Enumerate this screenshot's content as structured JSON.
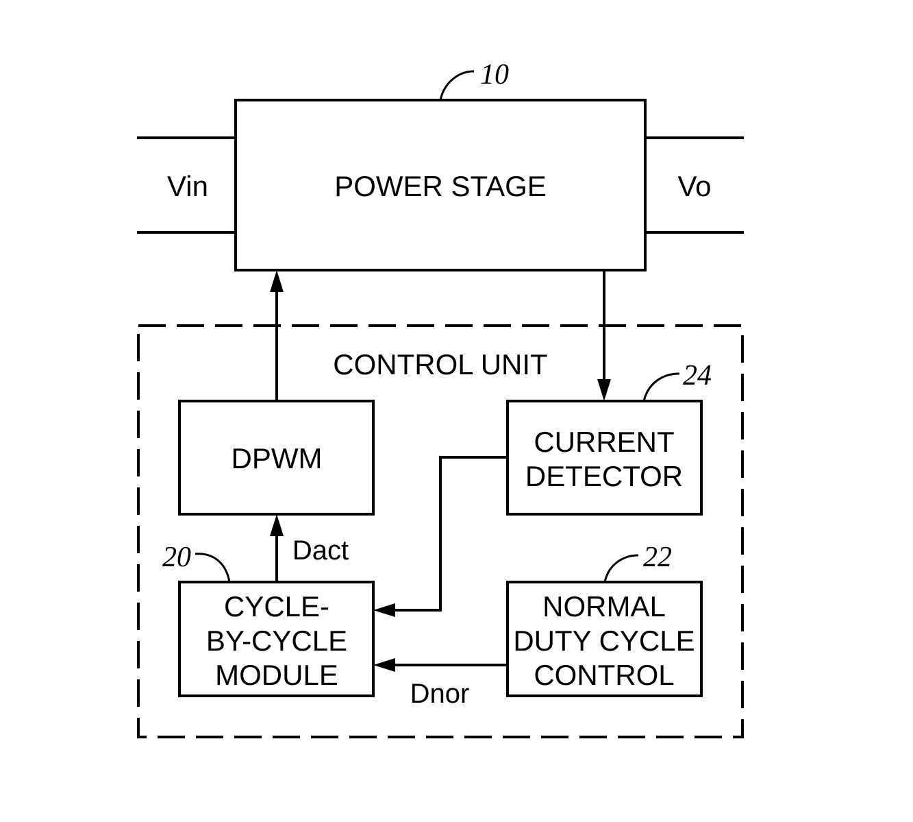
{
  "diagram": {
    "power_stage": {
      "label": "POWER STAGE",
      "ref": "10"
    },
    "input_terminal": {
      "label": "Vin"
    },
    "output_terminal": {
      "label": "Vo"
    },
    "control_unit": {
      "label": "CONTROL UNIT"
    },
    "dpwm": {
      "label": "DPWM"
    },
    "current_detector": {
      "lines": [
        "CURRENT",
        "DETECTOR"
      ],
      "ref": "24"
    },
    "cycle_by_cycle_module": {
      "lines": [
        "CYCLE-",
        "BY-CYCLE",
        "MODULE"
      ],
      "ref": "20"
    },
    "normal_duty_cycle_control": {
      "lines": [
        "NORMAL",
        "DUTY CYCLE",
        "CONTROL"
      ],
      "ref": "22"
    },
    "signals": {
      "dact": "Dact",
      "dnor": "Dnor"
    },
    "connections": [
      {
        "from": "dpwm",
        "to": "power_stage"
      },
      {
        "from": "power_stage",
        "to": "current_detector"
      },
      {
        "from": "current_detector",
        "to": "cycle_by_cycle_module"
      },
      {
        "from": "normal_duty_cycle_control",
        "to": "cycle_by_cycle_module",
        "signal": "Dnor"
      },
      {
        "from": "cycle_by_cycle_module",
        "to": "dpwm",
        "signal": "Dact"
      }
    ]
  }
}
